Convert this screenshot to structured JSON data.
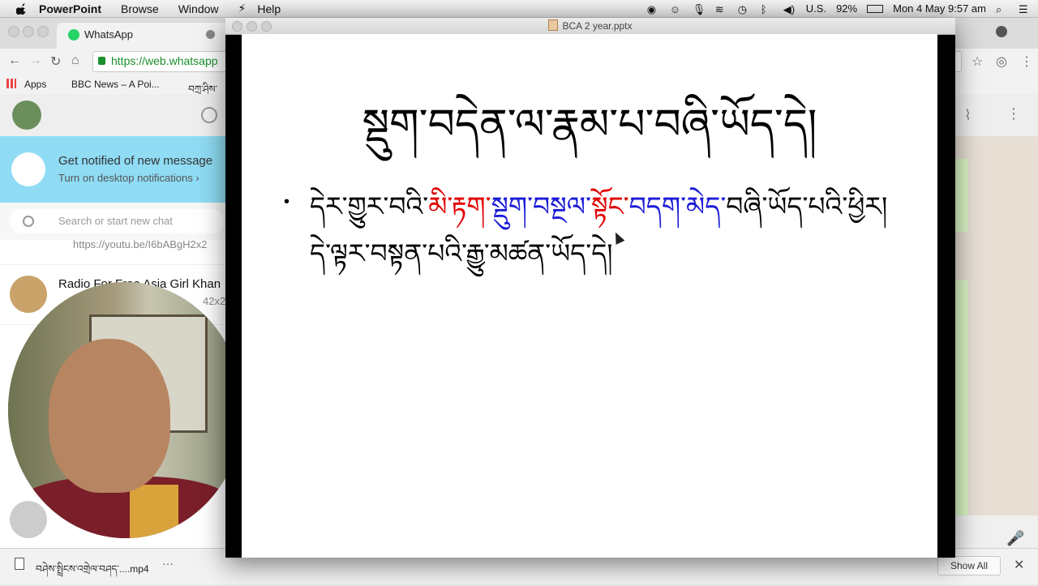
{
  "menubar": {
    "app": "PowerPoint",
    "items": [
      "Browse",
      "Window",
      "Help"
    ],
    "input_source": "U.S.",
    "battery": "92%",
    "datetime": "Mon 4 May  9:57 am"
  },
  "browser": {
    "tab_title": "WhatsApp",
    "url": "https://web.whatsapp",
    "bookmarks": [
      "Apps",
      "BBC News – A Poi...",
      "བཀྲ་ཤིས་"
    ]
  },
  "whatsapp": {
    "notify_title": "Get notified of new message",
    "notify_sub": "Turn on desktop notifications ›",
    "search_placeholder": "Search or start new chat",
    "chats": [
      {
        "name": "",
        "preview": "https://youtu.be/I6bABgH2x2"
      },
      {
        "name": "Radio For Free Asia Girl Khan",
        "preview": "42x2"
      }
    ]
  },
  "powerpoint": {
    "document_title": "BCA 2 year.pptx",
    "slide_title": "སྡུག་བདེན་ལ་རྣམ་པ་བཞི་ཡོད་དེ།",
    "bullet_line1": {
      "part1": "དེར་གྱུར་བའི་",
      "red1": "མི་རྟག་",
      "blue1": "སྡུག་བསྔལ་",
      "red2": "སྟོང་",
      "blue2": "བདག་མེད་",
      "part2": "བཞི་ཡོད་པའི་ཕྱིར།"
    },
    "bullet_line2": "དེ་ལྟར་བསྟན་པའི་རྒྱུ་མཚན་ཡོད་དེ།",
    "bullet_char": "•"
  },
  "downloads": {
    "file": "བཤེས་སྤྲིངས་འགྲེལ་བཤད་....mp4",
    "more": "···",
    "show_all": "Show All",
    "close": "✕"
  },
  "colors": {
    "red_text": "#e00000",
    "blue_text": "#1a1ad8",
    "whatsapp_green": "#25d366",
    "notify_bg": "#8fdcf4"
  }
}
